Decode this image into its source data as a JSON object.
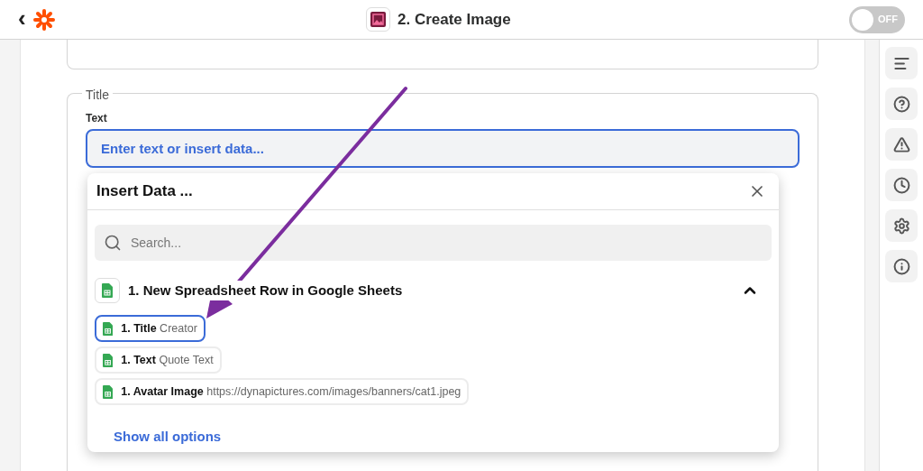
{
  "header": {
    "back": "‹",
    "title": "2. Create Image",
    "toggle": {
      "label": "OFF",
      "on": false
    }
  },
  "fieldset": {
    "legend": "Title",
    "field_label": "Text",
    "placeholder": "Enter text or insert data..."
  },
  "insert_data": {
    "title": "Insert Data ...",
    "search_placeholder": "Search...",
    "group": {
      "title": "1. New Spreadsheet Row in Google Sheets",
      "expanded": true,
      "items": [
        {
          "label": "1. Title",
          "value": "Creator",
          "selected": true
        },
        {
          "label": "1. Text",
          "value": "Quote Text",
          "selected": false
        },
        {
          "label": "1. Avatar Image",
          "value": "https://dynapictures.com/images/banners/cat1.jpeg",
          "selected": false
        }
      ]
    },
    "show_all": "Show all options"
  },
  "sidebar": {
    "items": [
      {
        "kind": "lines"
      },
      {
        "kind": "help"
      },
      {
        "kind": "warning"
      },
      {
        "kind": "clock"
      },
      {
        "kind": "gear"
      },
      {
        "kind": "info"
      }
    ]
  }
}
